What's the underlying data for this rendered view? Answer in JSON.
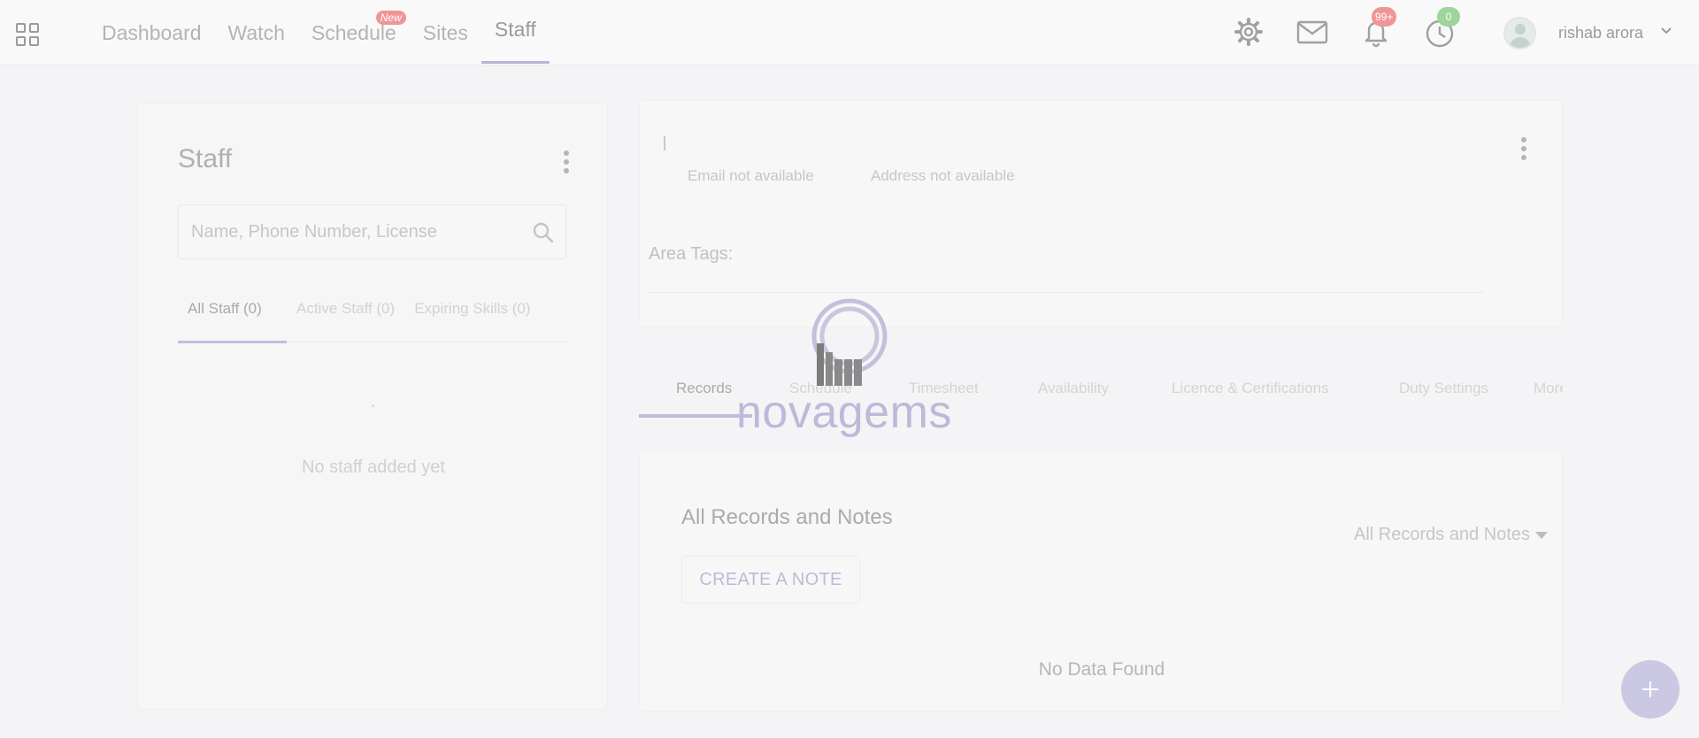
{
  "nav": {
    "items": [
      {
        "label": "Dashboard"
      },
      {
        "label": "Watch"
      },
      {
        "label": "Schedule",
        "badge": "New"
      },
      {
        "label": "Sites"
      },
      {
        "label": "Staff",
        "active": true
      }
    ]
  },
  "header": {
    "notifications_count": "99+",
    "timer_count": "0",
    "user_name": "rishab arora",
    "icons": [
      "apps-grid-icon",
      "gear-icon",
      "mail-icon",
      "bell-icon",
      "timer-icon",
      "avatar-icon",
      "chevron-down-icon"
    ]
  },
  "staff_panel": {
    "title": "Staff",
    "search_placeholder": "Name, Phone Number, License",
    "tabs": [
      {
        "label": "All Staff (0)",
        "active": true
      },
      {
        "label": "Active Staff (0)"
      },
      {
        "label": "Expiring Skills (0)"
      }
    ],
    "empty_text": "No staff added yet"
  },
  "profile": {
    "email": "Email not available",
    "address": "Address not available",
    "area_tags_label": "Area Tags:"
  },
  "detail_tabs": [
    {
      "label": "Records",
      "active": true
    },
    {
      "label": "Schedule"
    },
    {
      "label": "Timesheet"
    },
    {
      "label": "Availability"
    },
    {
      "label": "Licence & Certifications"
    },
    {
      "label": "Duty Settings"
    },
    {
      "label": "More"
    }
  ],
  "records": {
    "title": "All Records and Notes",
    "filter_value": "All Records and Notes",
    "create_label": "CREATE A NOTE",
    "empty_text": "No Data Found"
  },
  "loader": {
    "brand": "novagems"
  },
  "colors": {
    "accent": "#b8b4d6",
    "badge_red": "#f09595",
    "badge_green": "#9fd49a",
    "background": "#f4f4f6"
  }
}
